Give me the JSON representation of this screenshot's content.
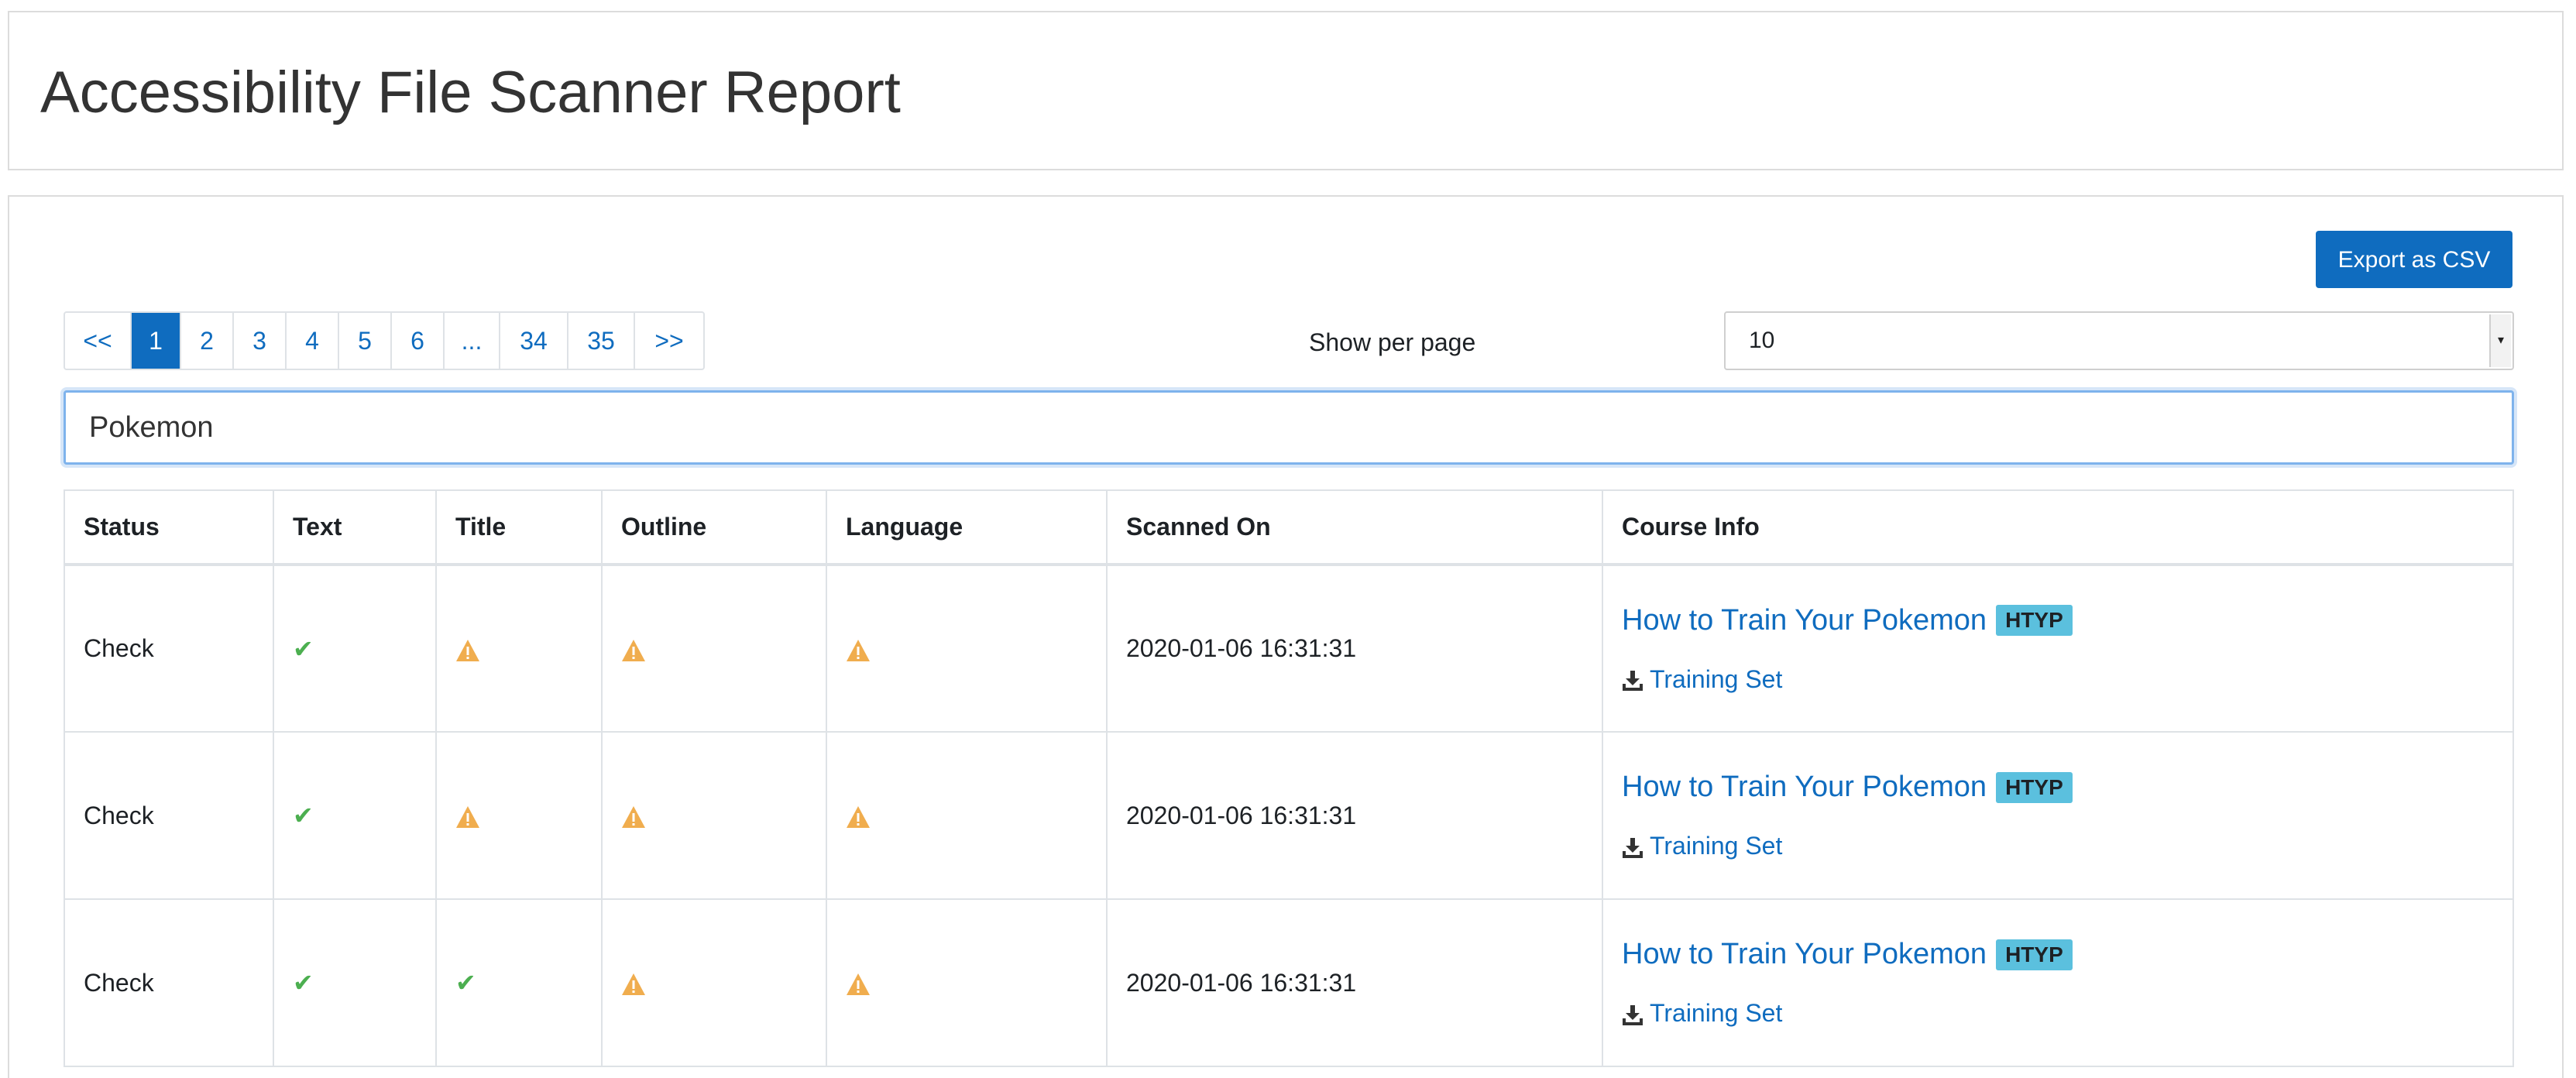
{
  "page_title": "Accessibility File Scanner Report",
  "export_button": "Export as CSV",
  "pagination": [
    "<<",
    "1",
    "2",
    "3",
    "4",
    "5",
    "6",
    "...",
    "34",
    "35",
    ">>"
  ],
  "pagination_active": "1",
  "per_page": {
    "label": "Show per page",
    "value": "10"
  },
  "search": {
    "value": "Pokemon"
  },
  "table": {
    "headers": [
      "Status",
      "Text",
      "Title",
      "Outline",
      "Language",
      "Scanned On",
      "Course Info"
    ],
    "rows": [
      {
        "status": "Check",
        "text": "ok",
        "title": "warning",
        "outline": "warning",
        "language": "warning",
        "scanned_on": "2020-01-06 16:31:31",
        "course_name": "How to Train Your Pokemon",
        "course_badge": "HTYP",
        "file_name": "Training Set"
      },
      {
        "status": "Check",
        "text": "ok",
        "title": "warning",
        "outline": "warning",
        "language": "warning",
        "scanned_on": "2020-01-06 16:31:31",
        "course_name": "How to Train Your Pokemon",
        "course_badge": "HTYP",
        "file_name": "Training Set"
      },
      {
        "status": "Check",
        "text": "ok",
        "title": "ok",
        "outline": "warning",
        "language": "warning",
        "scanned_on": "2020-01-06 16:31:31",
        "course_name": "How to Train Your Pokemon",
        "course_badge": "HTYP",
        "file_name": "Training Set"
      }
    ]
  },
  "colors": {
    "primary": "#0f6cbf",
    "success": "#4caf50",
    "warning": "#f0ad4e",
    "badge": "#5bc0de"
  }
}
